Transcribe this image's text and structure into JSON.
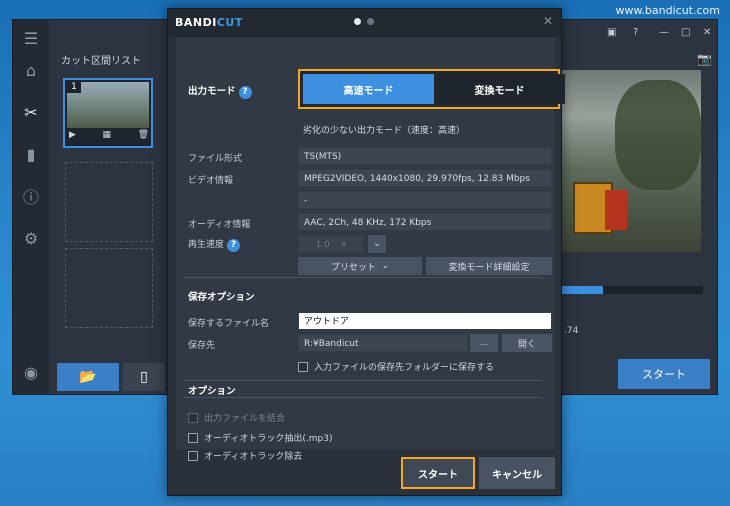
{
  "site_url": "www.bandicut.com",
  "main": {
    "panel_title": "カット区間リスト",
    "thumb_number": "1",
    "start_label": "スタート",
    "timecode": ".74"
  },
  "dialog": {
    "logo_bandi": "BANDI",
    "logo_cut": "CUT",
    "output_mode_label": "出力モード",
    "help_glyph": "?",
    "mode_fast": "高速モード",
    "mode_convert": "変換モード",
    "mode_hint": "劣化の少ない出力モード（速度：高速）",
    "file_format_label": "ファイル形式",
    "file_format_value": "TS(MTS)",
    "video_info_label": "ビデオ情報",
    "video_info_value": "MPEG2VIDEO, 1440x1080, 29.970fps, 12.83 Mbps",
    "video_info_value2": "-",
    "audio_info_label": "オーディオ情報",
    "audio_info_value": "AAC, 2Ch, 48 KHz, 172 Kbps",
    "speed_label": "再生速度",
    "speed_value": "1.0",
    "speed_unit": "x",
    "preset_label": "プリセット",
    "convert_detail_label": "変換モード詳細設定",
    "save_options_title": "保存オプション",
    "save_filename_label": "保存するファイル名",
    "save_filename_value": "アウトドア",
    "save_dest_label": "保存先",
    "save_dest_value": "R:¥Bandicut",
    "browse_label": "...",
    "open_label": "開く",
    "save_to_source_folder": "入力ファイルの保存先フォルダーに保存する",
    "options_title": "オプション",
    "merge_files": "出力ファイルを結合",
    "extract_audio": "オーディオトラック抽出(.mp3)",
    "remove_audio": "オーディオトラック除去",
    "start_button": "スタート",
    "cancel_button": "キャンセル"
  }
}
